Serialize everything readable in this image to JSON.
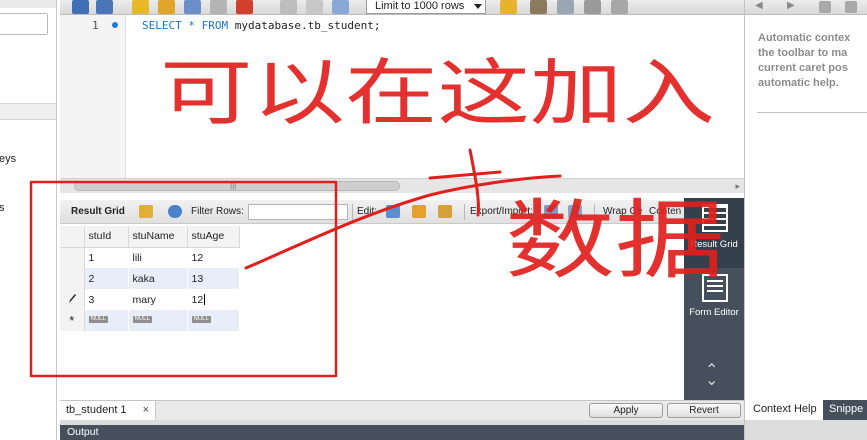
{
  "sidebar": {
    "items": [
      {
        "label": "eys"
      },
      {
        "label": "s"
      }
    ]
  },
  "toolbar": {
    "limit_select": "Limit to 1000 rows"
  },
  "editor": {
    "line_number": "1",
    "sql": {
      "select": "SELECT",
      "star": "*",
      "from": "FROM",
      "table": "mydatabase.tb_student;"
    }
  },
  "result_toolbar": {
    "result_grid": "Result Grid",
    "filter_rows": "Filter Rows:",
    "edit": "Edit:",
    "export_import": "Export/Import:",
    "wrap_cell": "Wrap Ce",
    "content": "Conten"
  },
  "grid": {
    "columns": [
      "stuId",
      "stuName",
      "stuAge"
    ],
    "rows": [
      [
        "1",
        "lili",
        "12"
      ],
      [
        "2",
        "kaka",
        "13"
      ],
      [
        "3",
        "mary",
        "12"
      ]
    ],
    "null_label": "NULL",
    "new_row_marker": "*"
  },
  "side_strip": {
    "result_grid_label": "Result Grid",
    "form_editor_label": "Form Editor"
  },
  "bottom": {
    "tab_label": "tb_student 1",
    "tab_close": "×",
    "apply_label": "Apply",
    "revert_label": "Revert",
    "output_label": "Output"
  },
  "right_panel": {
    "help_text": "Automatic contex\nthe toolbar to ma\ncurrent caret pos\nautomatic help.",
    "tab_context_help": "Context Help",
    "tab_snippets": "Snippe"
  },
  "annotation": {
    "text_line1": "可以在这加入",
    "text_line2": "数据",
    "color": "#e0201d"
  },
  "colors": {
    "accent_blue": "#1a73c8",
    "dark_panel": "#45505c",
    "annotation_red": "#e0201d"
  }
}
